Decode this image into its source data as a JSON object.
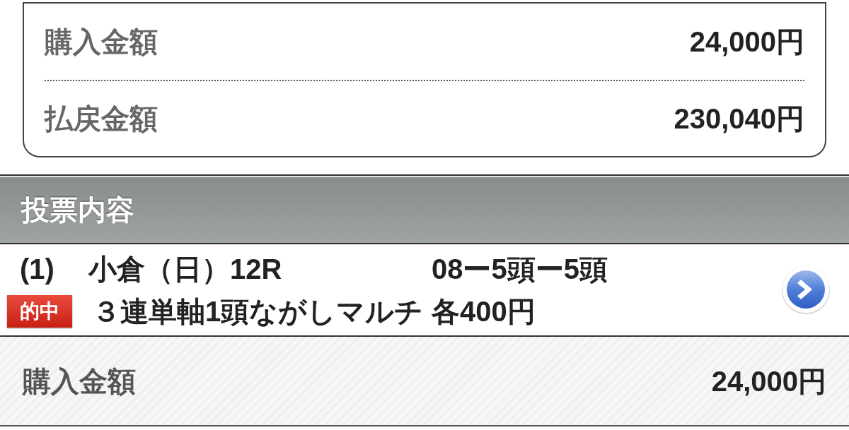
{
  "summary": {
    "rows": [
      {
        "label": "購入金額",
        "value": "24,000円"
      },
      {
        "label": "払戻金額",
        "value": "230,040円"
      }
    ]
  },
  "section": {
    "title": "投票内容"
  },
  "bets": [
    {
      "number": "(1)",
      "race": "小倉（日）12R",
      "combination": "08ー5頭ー5頭",
      "badge": "的中",
      "bet_type": "３連単軸1頭ながしマルチ",
      "amount": "各400円"
    }
  ],
  "total": {
    "label": "購入金額",
    "value": "24,000円"
  }
}
